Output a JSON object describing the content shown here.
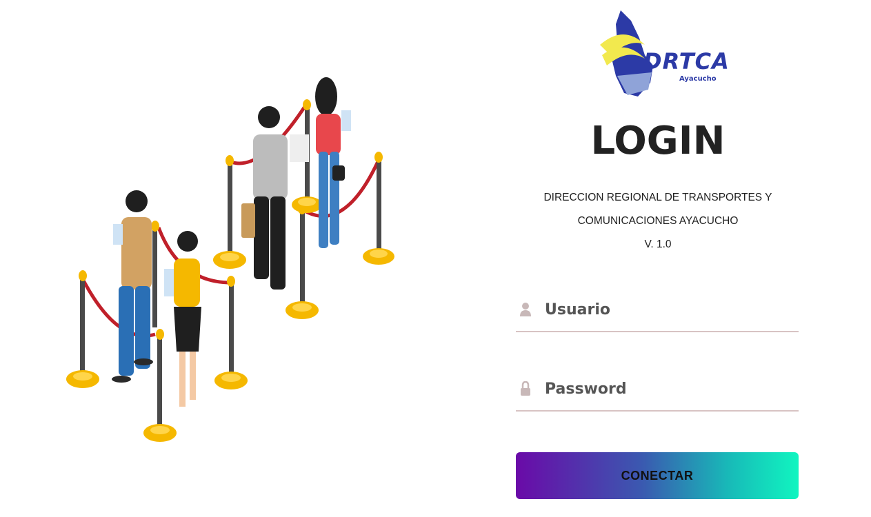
{
  "brand": {
    "logo_text": "DRTCA",
    "logo_subtext": "Ayacucho"
  },
  "login": {
    "title": "LOGIN",
    "subtitle_line1": "DIRECCION REGIONAL DE TRANSPORTES Y",
    "subtitle_line2": "COMUNICACIONES AYACUCHO",
    "version": "V. 1.0",
    "username_placeholder": "Usuario",
    "password_placeholder": "Password",
    "submit_label": "CONECTAR"
  },
  "colors": {
    "button_gradient_start": "#6a0aa8",
    "button_gradient_end": "#10f5c0",
    "logo_blue": "#2c3aa6",
    "logo_yellow": "#f2e94e",
    "field_underline": "#d8c3c3",
    "icon_gray": "#c8b8b8"
  },
  "icons": {
    "username_icon": "user-icon",
    "password_icon": "lock-icon"
  }
}
